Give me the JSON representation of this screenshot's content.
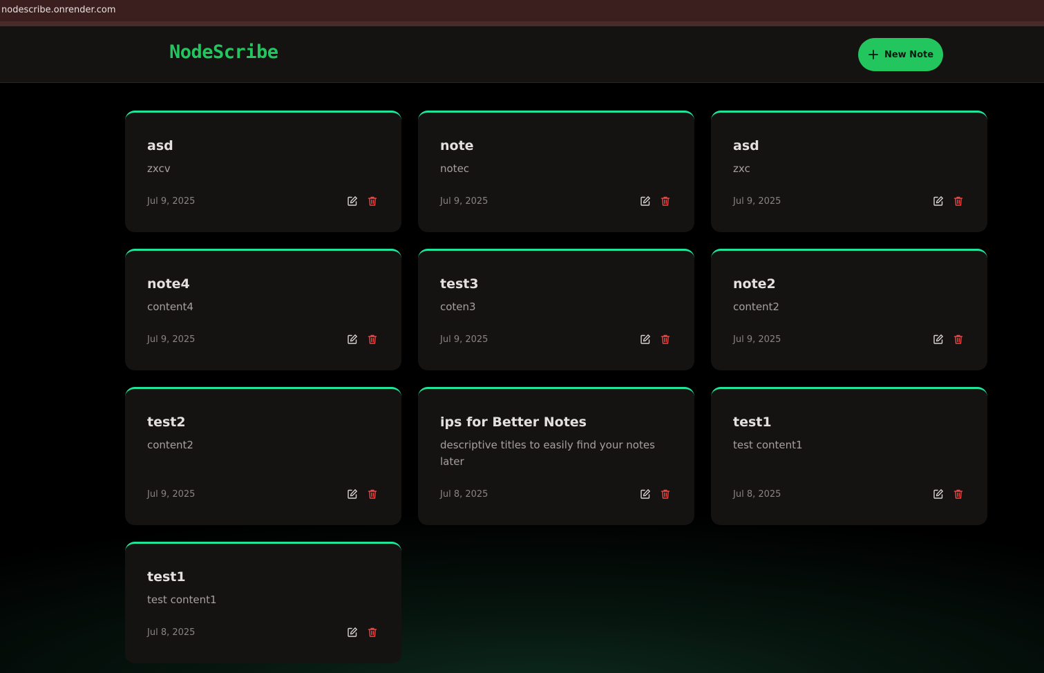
{
  "browser": {
    "url": "nodescribe.onrender.com"
  },
  "header": {
    "brand": "NodeScribe",
    "new_note_label": "New Note"
  },
  "colors": {
    "accent": "#22c55e",
    "card_border": "#1fe49a",
    "delete": "#ef4444"
  },
  "notes": [
    {
      "title": "asd",
      "content": "zxcv",
      "date": "Jul 9, 2025"
    },
    {
      "title": "note",
      "content": "notec",
      "date": "Jul 9, 2025"
    },
    {
      "title": "asd",
      "content": "zxc",
      "date": "Jul 9, 2025"
    },
    {
      "title": "note4",
      "content": "content4",
      "date": "Jul 9, 2025"
    },
    {
      "title": "test3",
      "content": "coten3",
      "date": "Jul 9, 2025"
    },
    {
      "title": "note2",
      "content": "content2",
      "date": "Jul 9, 2025"
    },
    {
      "title": "test2",
      "content": "content2",
      "date": "Jul 9, 2025"
    },
    {
      "title": "ips for Better Notes",
      "content": "descriptive titles to easily find your notes later",
      "date": "Jul 8, 2025"
    },
    {
      "title": "test1",
      "content": "test content1",
      "date": "Jul 8, 2025"
    },
    {
      "title": "test1",
      "content": "test content1",
      "date": "Jul 8, 2025"
    }
  ],
  "icons": {
    "edit": "edit-icon",
    "delete": "trash-icon",
    "new": "plus-icon"
  }
}
